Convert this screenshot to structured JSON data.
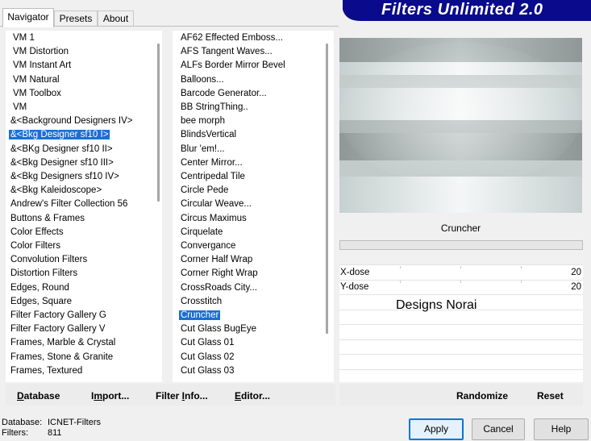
{
  "tabs": [
    {
      "label": "Navigator",
      "active": true
    },
    {
      "label": "Presets",
      "active": false
    },
    {
      "label": "About",
      "active": false
    }
  ],
  "banner": {
    "title": "Filters Unlimited 2.0",
    "color": "#0a0a8c"
  },
  "categories": {
    "items": [
      "VM 1",
      "VM Distortion",
      "VM Instant Art",
      "VM Natural",
      "VM Toolbox",
      "VM",
      "&<Background Designers IV>",
      "&<Bkg Designer sf10 I>",
      "&<BKg Designer sf10 II>",
      "&<Bkg Designer sf10 III>",
      "&<Bkg Designers sf10 IV>",
      "&<Bkg Kaleidoscope>",
      "Andrew's Filter Collection 56",
      "Buttons & Frames",
      "Color Effects",
      "Color Filters",
      "Convolution Filters",
      "Distortion Filters",
      "Edges, Round",
      "Edges, Square",
      "Filter Factory Gallery G",
      "Filter Factory Gallery V",
      "Frames, Marble & Crystal",
      "Frames, Stone & Granite",
      "Frames, Textured"
    ],
    "selected_index": 7
  },
  "filters": {
    "items": [
      "AF62 Effected Emboss...",
      "AFS Tangent Waves...",
      "ALFs Border Mirror Bevel",
      "Balloons...",
      "Barcode Generator...",
      "BB StringThing..",
      "bee morph",
      "BlindsVertical",
      "Blur 'em!...",
      "Center Mirror...",
      "Centripedal Tile",
      "Circle Pede",
      "Circular Weave...",
      "Circus Maximus",
      "Cirquelate",
      "Convergance",
      "Corner Half Wrap",
      "Corner Right Wrap",
      "CrossRoads City...",
      "Crosstitch",
      "Cruncher",
      "Cut Glass  BugEye",
      "Cut Glass 01",
      "Cut Glass 02",
      "Cut Glass 03"
    ],
    "selected_index": 20
  },
  "preview": {
    "filter_name": "Cruncher",
    "progress": 0
  },
  "params": [
    {
      "label": "X-dose",
      "value": "20"
    },
    {
      "label": "Y-dose",
      "value": "20"
    }
  ],
  "watermark": "Designs Norai",
  "bottom_buttons": {
    "database": "atabase",
    "database_u": "D",
    "import": "port...",
    "import_pre": "I",
    "import_u": "m",
    "filter_info_pre": "Filter ",
    "filter_info_u": "I",
    "filter_info": "nfo...",
    "editor_u": "E",
    "editor": "ditor...",
    "randomize": "Randomize",
    "reset": "Reset"
  },
  "status": {
    "db_label": "Database:",
    "db_value": "ICNET-Filters",
    "filters_label": "Filters:",
    "filters_value": "811"
  },
  "dialog_buttons": {
    "apply": "Apply",
    "cancel": "Cancel",
    "help": "Help"
  }
}
